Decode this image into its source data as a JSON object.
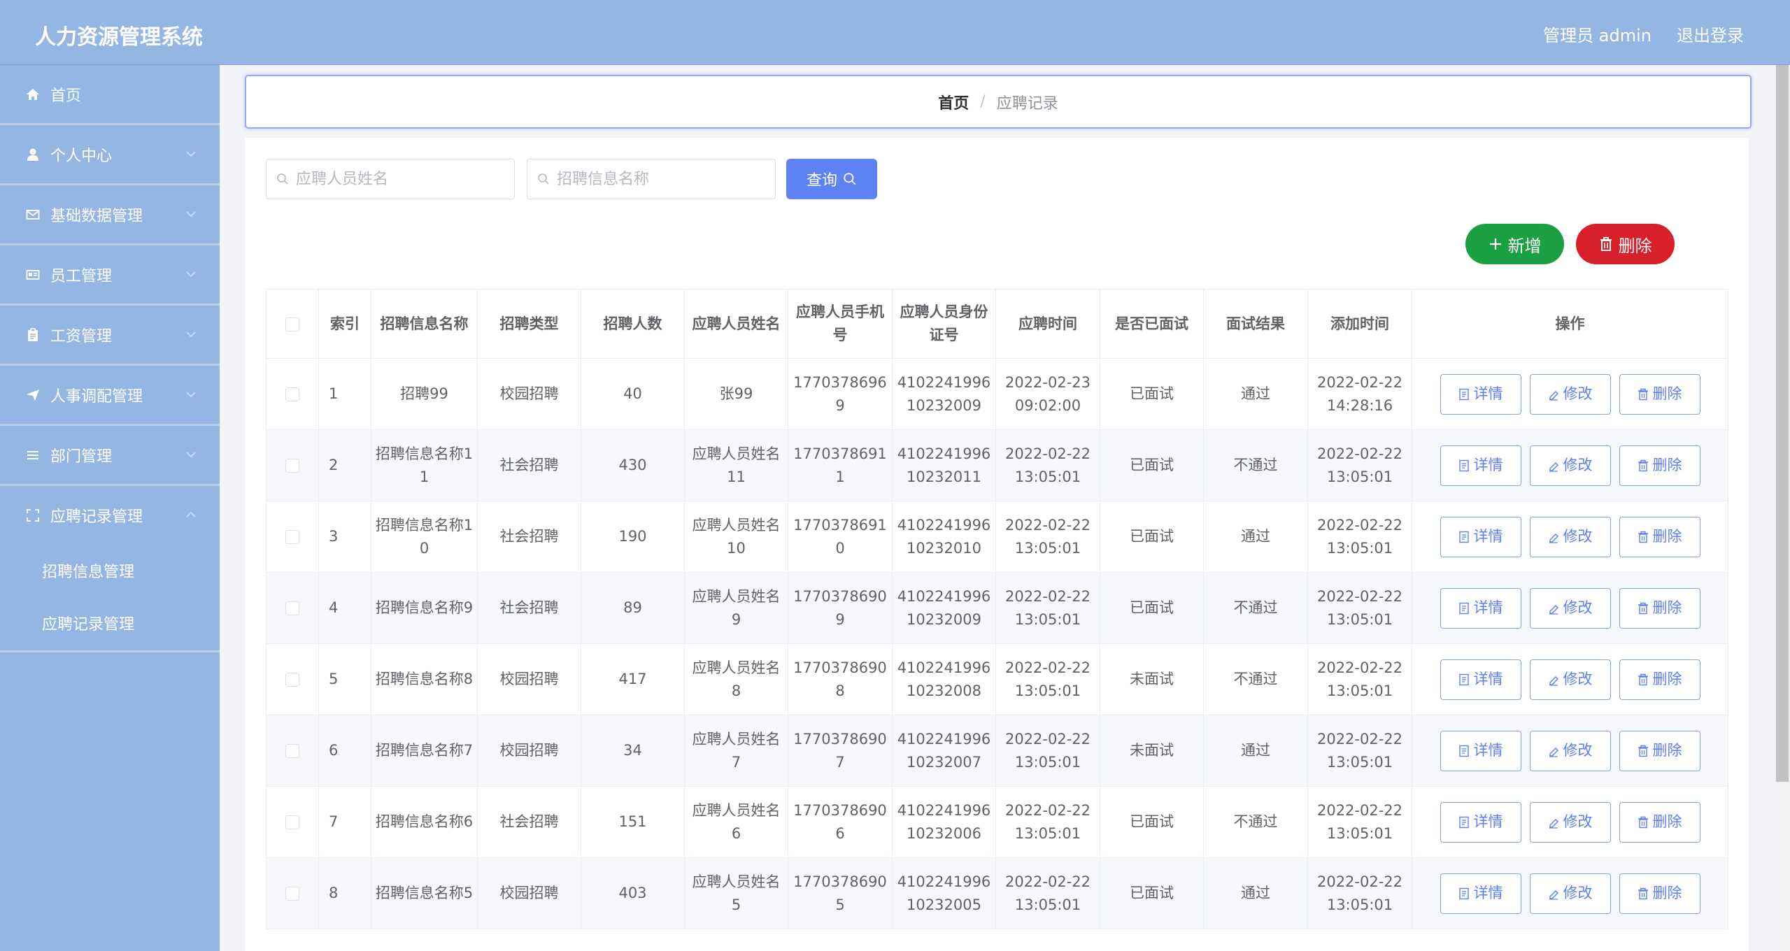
{
  "header": {
    "title": "人力资源管理系统",
    "user": "管理员 admin",
    "logout": "退出登录"
  },
  "sidebar": {
    "items": [
      {
        "label": "首页",
        "icon": "home-icon"
      },
      {
        "label": "个人中心",
        "icon": "user-icon"
      },
      {
        "label": "基础数据管理",
        "icon": "mail-icon"
      },
      {
        "label": "员工管理",
        "icon": "id-card-icon"
      },
      {
        "label": "工资管理",
        "icon": "clipboard-icon"
      },
      {
        "label": "人事调配管理",
        "icon": "send-icon"
      },
      {
        "label": "部门管理",
        "icon": "list-icon"
      },
      {
        "label": "应聘记录管理",
        "icon": "expand-icon"
      }
    ],
    "sub_items": [
      "招聘信息管理",
      "应聘记录管理"
    ]
  },
  "breadcrumb": {
    "home": "首页",
    "separator": "/",
    "current": "应聘记录"
  },
  "search": {
    "name_placeholder": "应聘人员姓名",
    "info_placeholder": "招聘信息名称",
    "query_label": "查询"
  },
  "actions": {
    "add_label": "新增",
    "delete_label": "删除"
  },
  "table": {
    "headers": [
      "索引",
      "招聘信息名称",
      "招聘类型",
      "招聘人数",
      "应聘人员姓名",
      "应聘人员手机号",
      "应聘人员身份证号",
      "应聘时间",
      "是否已面试",
      "面试结果",
      "添加时间",
      "操作"
    ],
    "row_actions": {
      "detail": "详情",
      "edit": "修改",
      "delete": "删除"
    },
    "rows": [
      {
        "index": "1",
        "info_name": "招聘99",
        "type": "校园招聘",
        "count": "40",
        "applicant": "张99",
        "phone": "17703786969",
        "id_number": "410224199610232009",
        "apply_time": "2022-02-23 09:02:00",
        "interviewed": "已面试",
        "result": "通过",
        "added_time": "2022-02-22 14:28:16"
      },
      {
        "index": "2",
        "info_name": "招聘信息名称11",
        "type": "社会招聘",
        "count": "430",
        "applicant": "应聘人员姓名11",
        "phone": "17703786911",
        "id_number": "410224199610232011",
        "apply_time": "2022-02-22 13:05:01",
        "interviewed": "已面试",
        "result": "不通过",
        "added_time": "2022-02-22 13:05:01"
      },
      {
        "index": "3",
        "info_name": "招聘信息名称10",
        "type": "社会招聘",
        "count": "190",
        "applicant": "应聘人员姓名10",
        "phone": "17703786910",
        "id_number": "410224199610232010",
        "apply_time": "2022-02-22 13:05:01",
        "interviewed": "已面试",
        "result": "通过",
        "added_time": "2022-02-22 13:05:01"
      },
      {
        "index": "4",
        "info_name": "招聘信息名称9",
        "type": "社会招聘",
        "count": "89",
        "applicant": "应聘人员姓名9",
        "phone": "17703786909",
        "id_number": "410224199610232009",
        "apply_time": "2022-02-22 13:05:01",
        "interviewed": "已面试",
        "result": "不通过",
        "added_time": "2022-02-22 13:05:01"
      },
      {
        "index": "5",
        "info_name": "招聘信息名称8",
        "type": "校园招聘",
        "count": "417",
        "applicant": "应聘人员姓名8",
        "phone": "17703786908",
        "id_number": "410224199610232008",
        "apply_time": "2022-02-22 13:05:01",
        "interviewed": "未面试",
        "result": "不通过",
        "added_time": "2022-02-22 13:05:01"
      },
      {
        "index": "6",
        "info_name": "招聘信息名称7",
        "type": "校园招聘",
        "count": "34",
        "applicant": "应聘人员姓名7",
        "phone": "17703786907",
        "id_number": "410224199610232007",
        "apply_time": "2022-02-22 13:05:01",
        "interviewed": "未面试",
        "result": "通过",
        "added_time": "2022-02-22 13:05:01"
      },
      {
        "index": "7",
        "info_name": "招聘信息名称6",
        "type": "社会招聘",
        "count": "151",
        "applicant": "应聘人员姓名6",
        "phone": "17703786906",
        "id_number": "410224199610232006",
        "apply_time": "2022-02-22 13:05:01",
        "interviewed": "已面试",
        "result": "不通过",
        "added_time": "2022-02-22 13:05:01"
      },
      {
        "index": "8",
        "info_name": "招聘信息名称5",
        "type": "校园招聘",
        "count": "403",
        "applicant": "应聘人员姓名5",
        "phone": "17703786905",
        "id_number": "410224199610232005",
        "apply_time": "2022-02-22 13:05:01",
        "interviewed": "已面试",
        "result": "通过",
        "added_time": "2022-02-22 13:05:01"
      }
    ]
  },
  "colors": {
    "header_bg": "#94b6e2",
    "primary": "#5e82f4",
    "success": "#1a9f43",
    "danger": "#d8202a"
  }
}
